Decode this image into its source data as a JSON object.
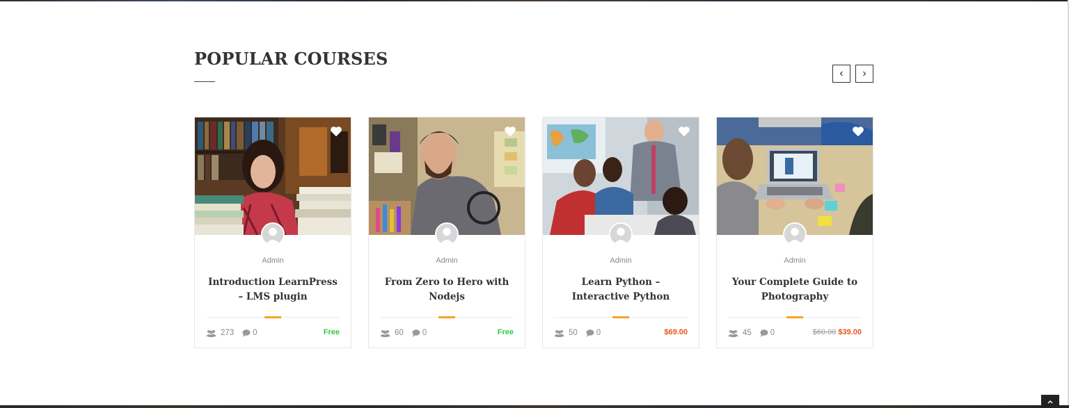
{
  "section": {
    "title": "POPULAR COURSES"
  },
  "nav": {
    "prev_icon": "chevron-left-icon",
    "next_icon": "chevron-right-icon"
  },
  "courses": [
    {
      "author": "Admin",
      "title": "Introduction LearnPress – LMS plugin",
      "students": "273",
      "comments": "0",
      "price": "Free",
      "old_price": ""
    },
    {
      "author": "Admin",
      "title": "From Zero to Hero with Nodejs",
      "students": "60",
      "comments": "0",
      "price": "Free",
      "old_price": ""
    },
    {
      "author": "Admin",
      "title": "Learn Python – Interactive Python",
      "students": "50",
      "comments": "0",
      "price": "$69.00",
      "old_price": ""
    },
    {
      "author": "Admin",
      "title": "Your Complete Guide to Photography",
      "students": "45",
      "comments": "0",
      "price": "$39.00",
      "old_price": "$60.00"
    }
  ],
  "colors": {
    "accent": "#f5a623",
    "free": "#2ecc40",
    "paid": "#e8561c",
    "text": "#333333"
  }
}
